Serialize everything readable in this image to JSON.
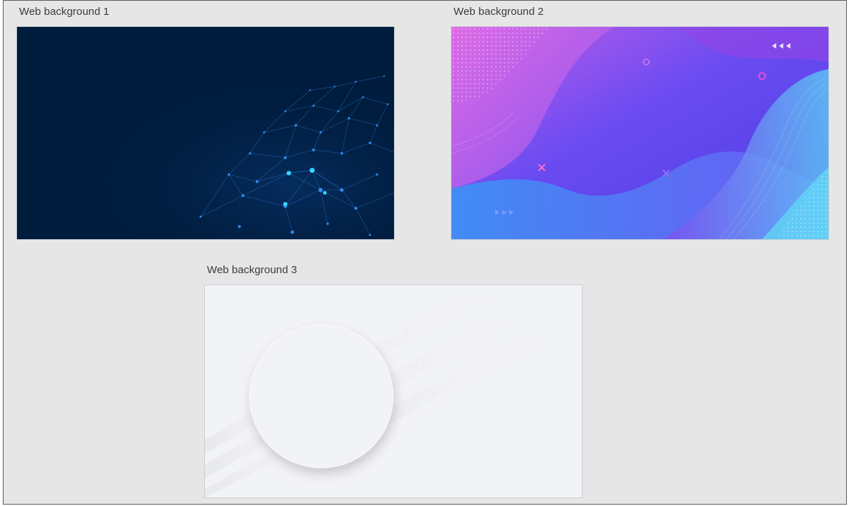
{
  "backgrounds": [
    {
      "label": "Web background 1",
      "description_icon": "network-plexus-image",
      "color": "#001c3d"
    },
    {
      "label": "Web background 2",
      "description_icon": "fluid-gradient-image",
      "color": "#6a4bf2"
    },
    {
      "label": "Web background 3",
      "description_icon": "neumorphic-circle-image",
      "color": "#f2f3f6"
    }
  ]
}
